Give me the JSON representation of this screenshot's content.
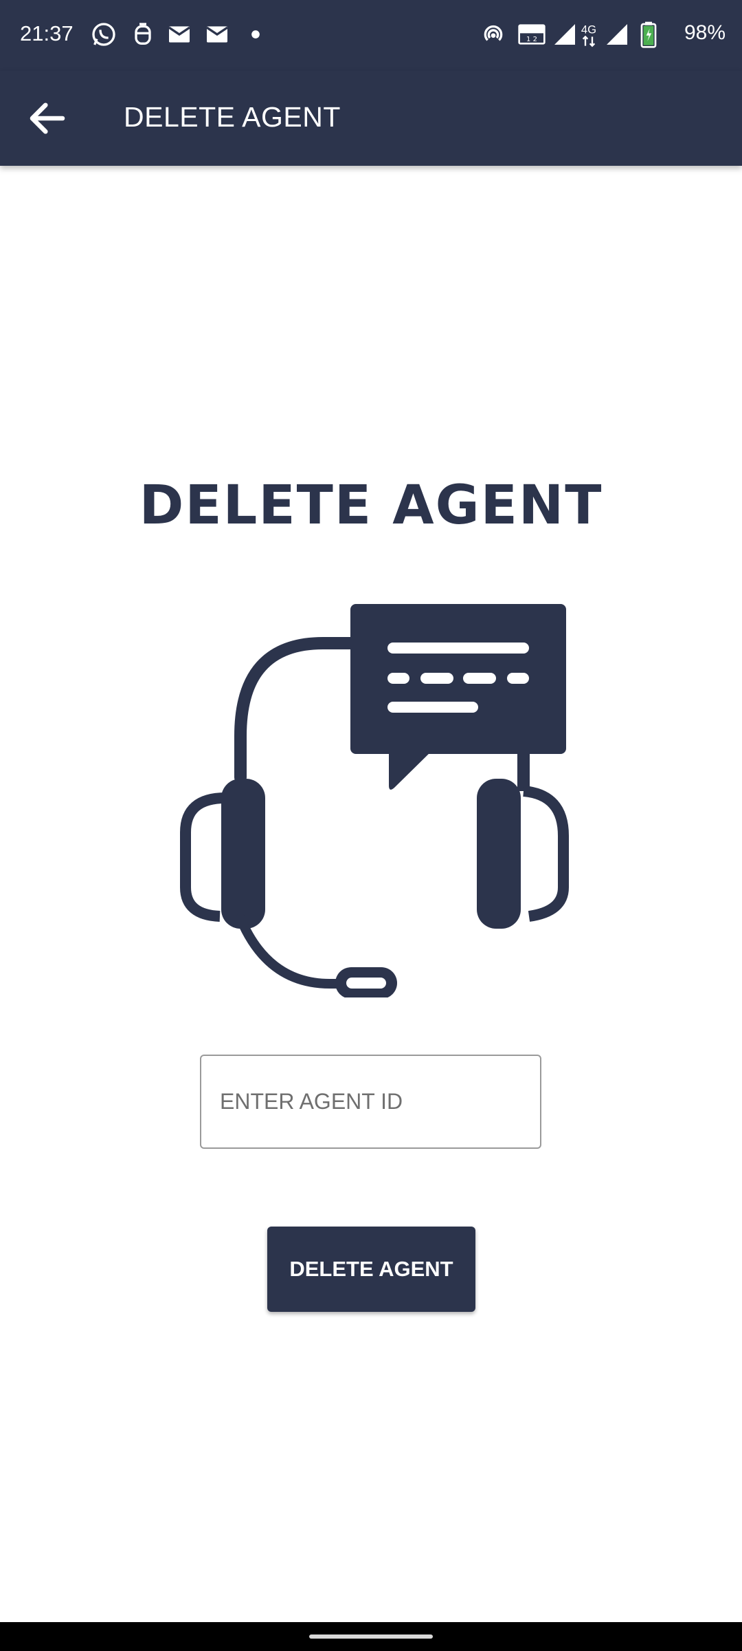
{
  "status_bar": {
    "time": "21:37",
    "battery": "98%",
    "network": "4G",
    "icons": [
      "whatsapp-icon",
      "app-icon",
      "mail-icon",
      "mail-icon",
      "dot-icon",
      "hotspot-icon",
      "volte-icon",
      "signal-icon",
      "signal-icon",
      "battery-icon"
    ]
  },
  "app_bar": {
    "title": "DELETE AGENT",
    "back_icon": "arrow-back-icon"
  },
  "main": {
    "heading": "DELETE AGENT",
    "illustration_icon": "headset-chat-icon",
    "input": {
      "placeholder": "ENTER AGENT ID",
      "value": ""
    },
    "button_label": "DELETE AGENT"
  },
  "colors": {
    "primary": "#2c344c",
    "background": "#ffffff"
  }
}
